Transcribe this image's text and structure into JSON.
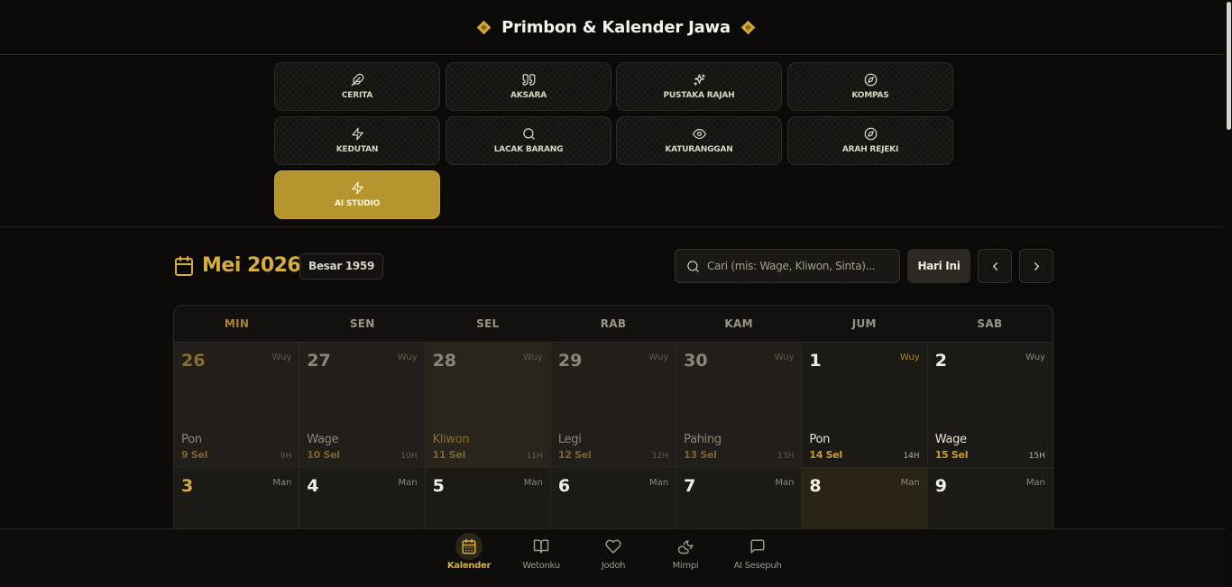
{
  "header": {
    "title": "Primbon & Kalender Jawa"
  },
  "menu": [
    {
      "label": "CERITA",
      "icon": "feather-icon"
    },
    {
      "label": "AKSARA",
      "icon": "quote-icon"
    },
    {
      "label": "PUSTAKA RAJAH",
      "icon": "sparkles-icon"
    },
    {
      "label": "KOMPAS",
      "icon": "compass-icon"
    },
    {
      "label": "KEDUTAN",
      "icon": "zap-icon"
    },
    {
      "label": "LACAK BARANG",
      "icon": "search-icon"
    },
    {
      "label": "KATURANGGAN",
      "icon": "eye-icon"
    },
    {
      "label": "ARAH REJEKI",
      "icon": "compass-icon"
    },
    {
      "label": "AI STUDIO",
      "icon": "zap-icon",
      "active": true
    }
  ],
  "calendar": {
    "title": "Mei 2026",
    "javanese_month": "Besar 1959",
    "search_placeholder": "Cari (mis: Wage, Kliwon, Sinta)...",
    "today_label": "Hari Ini",
    "weekdays": [
      "MIN",
      "SEN",
      "SEL",
      "RAB",
      "KAM",
      "JUM",
      "SAB"
    ],
    "weeks": [
      [
        {
          "day": "26",
          "wuku": "Wuy",
          "pasaran": "Pon",
          "jdate": "9 Sel",
          "h": "9H"
        },
        {
          "day": "27",
          "wuku": "Wuy",
          "pasaran": "Wage",
          "jdate": "10 Sel",
          "h": "10H"
        },
        {
          "day": "28",
          "wuku": "Wuy",
          "pasaran": "Kliwon",
          "jdate": "11 Sel",
          "h": "11H"
        },
        {
          "day": "29",
          "wuku": "Wuy",
          "pasaran": "Legi",
          "jdate": "12 Sel",
          "h": "12H"
        },
        {
          "day": "30",
          "wuku": "Wuy",
          "pasaran": "Pahing",
          "jdate": "13 Sel",
          "h": "13H"
        },
        {
          "day": "1",
          "wuku": "Wuy",
          "pasaran": "Pon",
          "jdate": "14 Sel",
          "h": "14H"
        },
        {
          "day": "2",
          "wuku": "Wuy",
          "pasaran": "Wage",
          "jdate": "15 Sel",
          "h": "15H"
        }
      ],
      [
        {
          "day": "3",
          "wuku": "Man"
        },
        {
          "day": "4",
          "wuku": "Man"
        },
        {
          "day": "5",
          "wuku": "Man"
        },
        {
          "day": "6",
          "wuku": "Man"
        },
        {
          "day": "7",
          "wuku": "Man"
        },
        {
          "day": "8",
          "wuku": "Man"
        },
        {
          "day": "9",
          "wuku": "Man"
        }
      ]
    ]
  },
  "bottom_nav": [
    {
      "label": "Kalender",
      "icon": "calendar-icon",
      "active": true
    },
    {
      "label": "Wetonku",
      "icon": "book-open-icon"
    },
    {
      "label": "Jodoh",
      "icon": "heart-icon"
    },
    {
      "label": "Mimpi",
      "icon": "cloud-moon-icon"
    },
    {
      "label": "AI Sesepuh",
      "icon": "message-square-icon"
    }
  ],
  "colors": {
    "accent": "#d9ad3b",
    "active_button": "#b5952e",
    "background": "#0b0a08"
  }
}
